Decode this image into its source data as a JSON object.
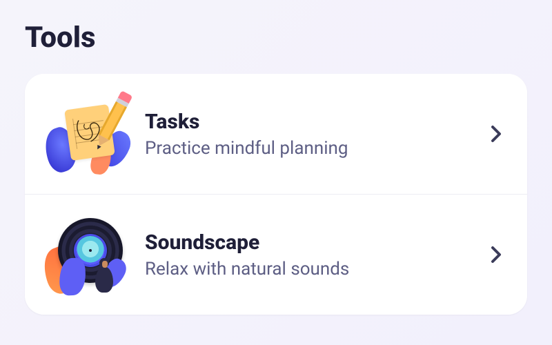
{
  "section_title": "Tools",
  "items": [
    {
      "id": "tasks",
      "title": "Tasks",
      "subtitle": "Practice mindful planning",
      "icon": "tasks-illustration"
    },
    {
      "id": "soundscape",
      "title": "Soundscape",
      "subtitle": "Relax with natural sounds",
      "icon": "soundscape-illustration"
    }
  ]
}
